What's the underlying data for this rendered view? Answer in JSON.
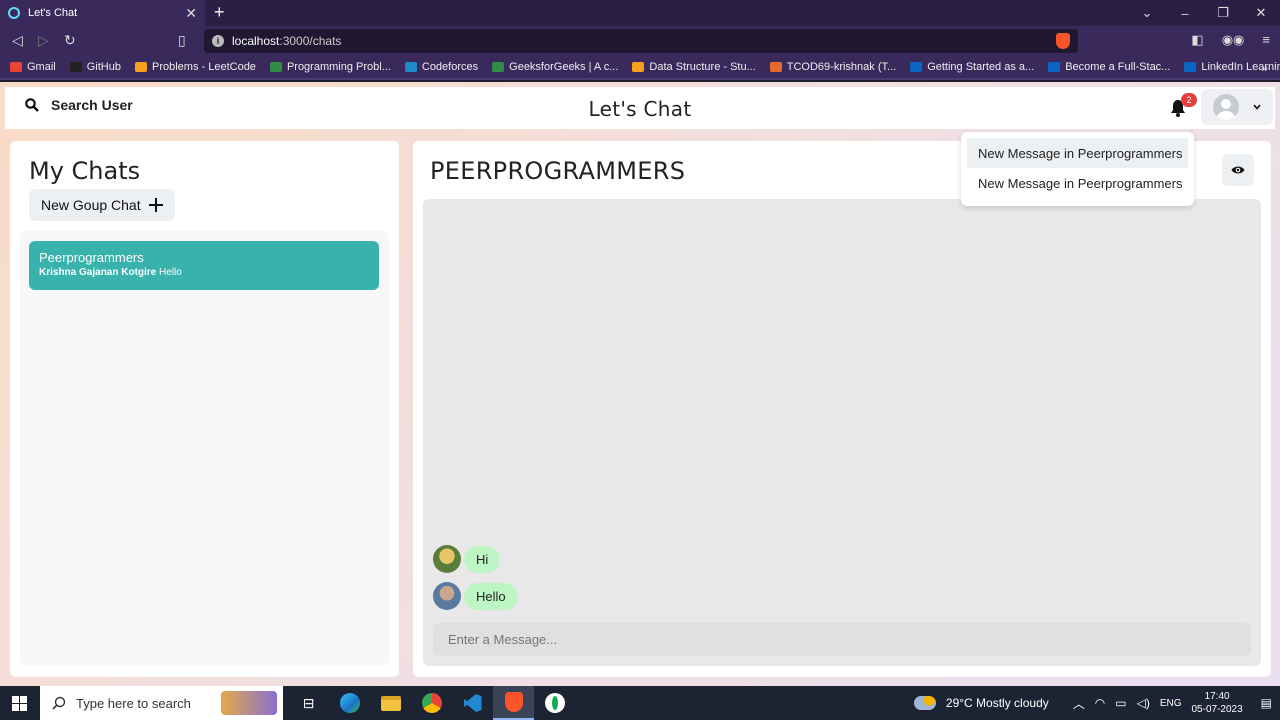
{
  "browser": {
    "tab_title": "Let's Chat",
    "tab_close": "✕",
    "new_tab": "+",
    "url_host": "localhost",
    "url_path": ":3000/chats",
    "bookmarks": [
      {
        "label": "Gmail",
        "color": "#ea4335"
      },
      {
        "label": "GitHub",
        "color": "#222222"
      },
      {
        "label": "Problems - LeetCode",
        "color": "#f89f1b"
      },
      {
        "label": "Programming Probl...",
        "color": "#2f8d46"
      },
      {
        "label": "Codeforces",
        "color": "#1f8acb"
      },
      {
        "label": "GeeksforGeeks | A c...",
        "color": "#2f8d46"
      },
      {
        "label": "Data Structure - Stu...",
        "color": "#f89f1b"
      },
      {
        "label": "TCOD69-krishnak (T...",
        "color": "#e66a2c"
      },
      {
        "label": "Getting Started as a...",
        "color": "#0a66c2"
      },
      {
        "label": "Become a Full-Stac...",
        "color": "#0a66c2"
      },
      {
        "label": "LinkedIn Learning:...",
        "color": "#0a66c2"
      }
    ]
  },
  "header": {
    "search_label": "Search User",
    "app_title": "Let's Chat",
    "notification_count": "2"
  },
  "left_panel": {
    "title": "My Chats",
    "new_group_label": "New Goup Chat",
    "chats": [
      {
        "name": "Peerprogrammers",
        "latest_sender": "Krishna Gajanan Kotgire",
        "latest_message": "Hello"
      }
    ]
  },
  "right_panel": {
    "chat_title": "PEERPROGRAMMERS",
    "messages": [
      {
        "text": "Hi"
      },
      {
        "text": "Hello"
      }
    ],
    "input_placeholder": "Enter a Message..."
  },
  "notifications": [
    "New Message in Peerprogrammers",
    "New Message in Peerprogrammers"
  ],
  "taskbar": {
    "search_placeholder": "Type here to search",
    "weather": "29°C  Mostly cloudy",
    "language": "ENG",
    "time": "17:40",
    "date": "05-07-2023"
  },
  "colors": {
    "accent_teal": "#38b2ac",
    "bubble_green": "#bef5c5",
    "badge_red": "#e53e3e"
  }
}
